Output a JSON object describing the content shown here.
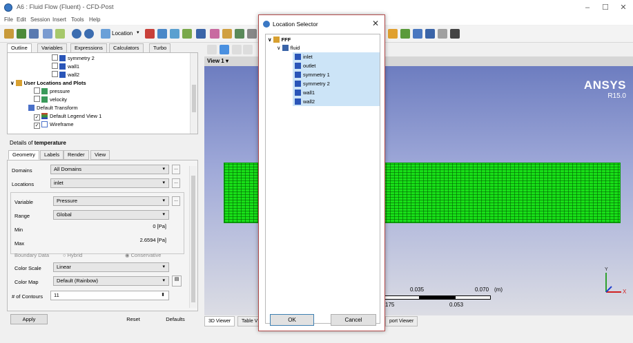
{
  "window": {
    "title": "A6 : Fluid Flow (Fluent) - CFD-Post",
    "controls": [
      "–",
      "☐",
      "✕"
    ]
  },
  "menu": [
    "File",
    "Edit",
    "Session",
    "Insert",
    "Tools",
    "Help"
  ],
  "toolbar": {
    "location_label": "Location"
  },
  "outline_tabs": [
    "Outline",
    "Variables",
    "Expressions",
    "Calculators",
    "Turbo"
  ],
  "tree": {
    "items": [
      "symmetry 2",
      "wall1",
      "wall2"
    ],
    "group_label": "User Locations and Plots",
    "sub_items": [
      "pressure",
      "velocity",
      "Default Transform",
      "Default Legend View 1",
      "Wireframe"
    ]
  },
  "details": {
    "prefix": "Details of ",
    "name": "temperature",
    "tabs": [
      "Geometry",
      "Labels",
      "Render",
      "View"
    ],
    "domains_label": "Domains",
    "domains_value": "All Domains",
    "locations_label": "Locations",
    "locations_value": "inlet",
    "variable_label": "Variable",
    "variable_value": "Pressure",
    "range_label": "Range",
    "range_value": "Global",
    "min_label": "Min",
    "min_value": "0 [Pa]",
    "max_label": "Max",
    "max_value": "2.6594 [Pa]",
    "boundary_label": "Boundary Data",
    "hybrid_label": "Hybrid",
    "conservative_label": "Conservative",
    "colorscale_label": "Color Scale",
    "colorscale_value": "Linear",
    "colormap_label": "Color Map",
    "colormap_value": "Default (Rainbow)",
    "contours_label": "# of Contours",
    "contours_value": "11",
    "dots": "...",
    "apply": "Apply",
    "reset": "Reset",
    "defaults": "Defaults"
  },
  "viewer": {
    "view_label": "View 1",
    "brand": "ANSYS",
    "version": "R15.0",
    "scale": {
      "t1": "0.035",
      "t2": "0.070",
      "unit": "(m)",
      "b1": "175",
      "b2": "0.053"
    },
    "tabs": [
      "3D Viewer",
      "Table V",
      "port Viewer"
    ]
  },
  "dialog": {
    "title": "Location Selector",
    "root": "FFF",
    "domain": "fluid",
    "locations": [
      "inlet",
      "outlet",
      "symmetry 1",
      "symmetry 2",
      "wall1",
      "wall2"
    ],
    "ok": "OK",
    "cancel": "Cancel",
    "close": "✕"
  },
  "colors": {
    "accent": "#3a78c4",
    "mesh": "#18e018",
    "selection": "#cce4f7",
    "dialog_border": "#b04848"
  }
}
